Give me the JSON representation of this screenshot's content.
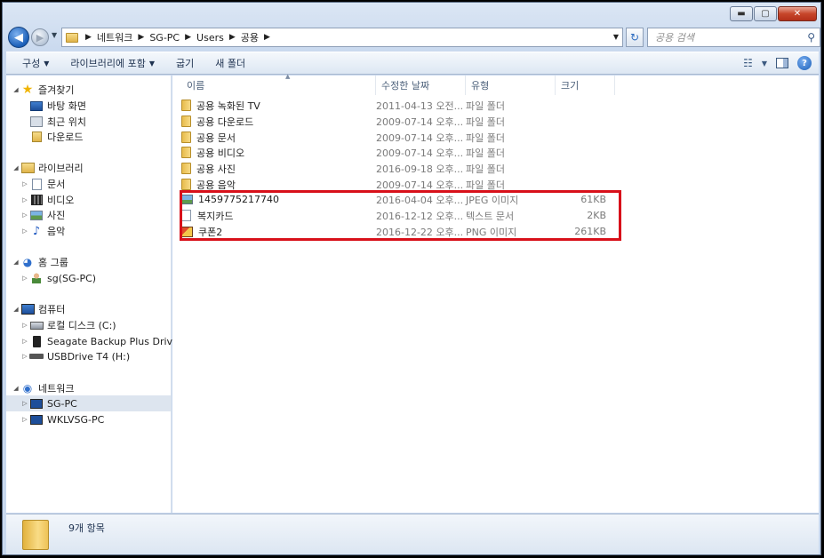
{
  "address": {
    "crumbs": [
      "네트워크",
      "SG-PC",
      "Users",
      "공용"
    ]
  },
  "search": {
    "placeholder": "공용 검색"
  },
  "toolbar": {
    "organize": "구성",
    "include_library": "라이브러리에 포함",
    "burn": "굽기",
    "new_folder": "새 폴더"
  },
  "nav": {
    "favorites": "즐겨찾기",
    "desktop": "바탕 화면",
    "recent": "최근 위치",
    "downloads": "다운로드",
    "libraries": "라이브러리",
    "documents": "문서",
    "videos": "비디오",
    "pictures": "사진",
    "music": "음악",
    "homegroup": "홈 그룹",
    "homegroup_user": "sg(SG-PC)",
    "computer": "컴퓨터",
    "local_disk": "로컬 디스크 (C:)",
    "seagate": "Seagate Backup Plus Drive (G:)",
    "usb": "USBDrive T4 (H:)",
    "network": "네트워크",
    "pc1": "SG-PC",
    "pc2": "WKLVSG-PC"
  },
  "columns": {
    "name": "이름",
    "date": "수정한 날짜",
    "type": "유형",
    "size": "크기"
  },
  "files": [
    {
      "name": "공용 녹화된 TV",
      "date": "2011-04-13 오전...",
      "type": "파일 폴더",
      "size": ""
    },
    {
      "name": "공용 다운로드",
      "date": "2009-07-14 오후...",
      "type": "파일 폴더",
      "size": ""
    },
    {
      "name": "공용 문서",
      "date": "2009-07-14 오후...",
      "type": "파일 폴더",
      "size": ""
    },
    {
      "name": "공용 비디오",
      "date": "2009-07-14 오후...",
      "type": "파일 폴더",
      "size": ""
    },
    {
      "name": "공용 사진",
      "date": "2016-09-18 오후...",
      "type": "파일 폴더",
      "size": ""
    },
    {
      "name": "공용 음악",
      "date": "2009-07-14 오후...",
      "type": "파일 폴더",
      "size": ""
    },
    {
      "name": "1459775217740",
      "date": "2016-04-04 오후...",
      "type": "JPEG 이미지",
      "size": "61KB"
    },
    {
      "name": "복지카드",
      "date": "2016-12-12 오후...",
      "type": "텍스트 문서",
      "size": "2KB"
    },
    {
      "name": "쿠폰2",
      "date": "2016-12-22 오후...",
      "type": "PNG 이미지",
      "size": "261KB"
    }
  ],
  "status": {
    "count": "9개 항목"
  },
  "colors": {
    "highlight": "#d8101a",
    "accent": "#1b5fb8"
  }
}
